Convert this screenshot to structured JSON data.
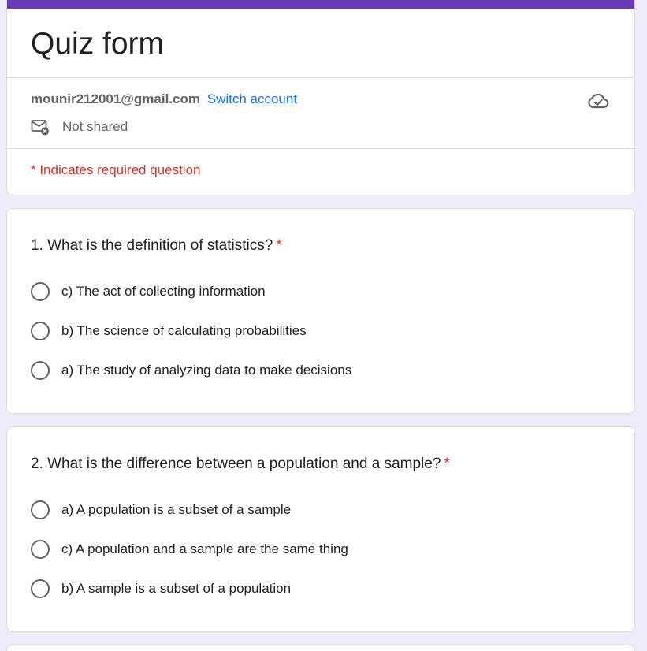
{
  "form": {
    "title": "Quiz form",
    "accent_color": "#673ab7"
  },
  "account": {
    "email": "mounir212001@gmail.com",
    "switch_label": "Switch account",
    "sharing_status": "Not shared",
    "save_status_icon": "cloud-check-icon"
  },
  "required_note": "* Indicates required question",
  "questions": [
    {
      "title": "1. What is the definition of statistics?",
      "required_marker": "*",
      "options": [
        "c) The act of collecting information",
        "b) The science of calculating probabilities",
        "a) The study of analyzing data to make decisions"
      ]
    },
    {
      "title": "2. What is the difference between a population and a sample?",
      "required_marker": "*",
      "options": [
        "a) A population is a subset of a sample",
        "c) A population and a sample are the same thing",
        "b) A sample is a subset of a population"
      ]
    }
  ]
}
